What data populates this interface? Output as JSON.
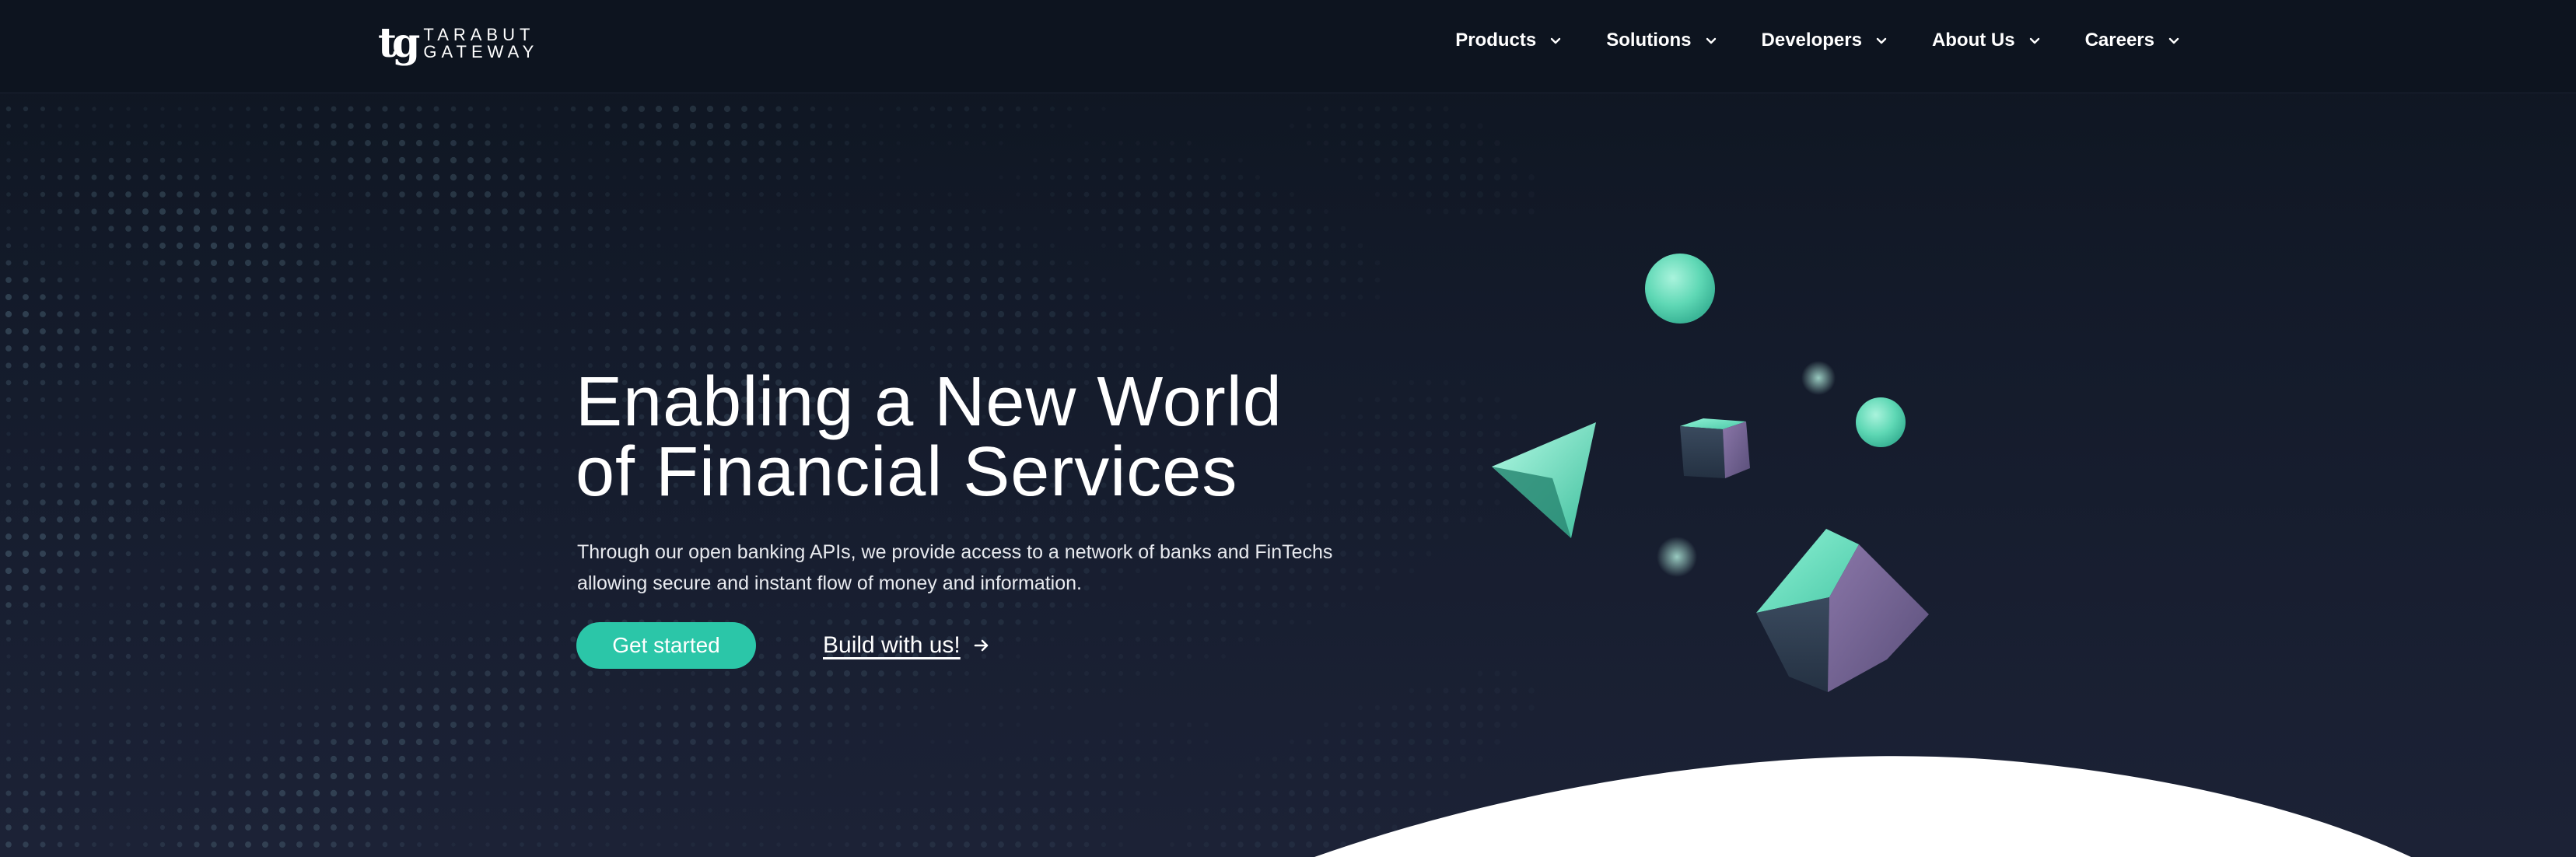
{
  "brand": {
    "mark": "tg",
    "name_line1": "TARABUT",
    "name_line2": "GATEWAY"
  },
  "nav": {
    "items": [
      {
        "label": "Products"
      },
      {
        "label": "Solutions"
      },
      {
        "label": "Developers"
      },
      {
        "label": "About Us"
      },
      {
        "label": "Careers"
      }
    ]
  },
  "hero": {
    "headline_line1": "Enabling a New World",
    "headline_line2": "of Financial Services",
    "subtext_line1": "Through our open banking APIs, we provide access to a network of banks and FinTechs",
    "subtext_line2": "allowing secure and instant flow of money and information.",
    "primary_cta": "Get started",
    "secondary_cta": "Build with us!"
  },
  "colors": {
    "accent": "#2bc6a8",
    "background": "#141b2b",
    "header": "#0d141f"
  },
  "icons": {
    "nav_chevron": "chevron-down-icon",
    "cta_arrow": "arrow-right-icon"
  }
}
